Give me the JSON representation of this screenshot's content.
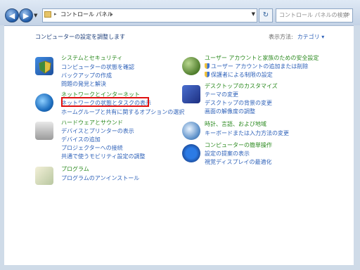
{
  "address": {
    "crumbs": [
      "コントロール パネル"
    ],
    "search_placeholder": "コントロール パネルの検索"
  },
  "heading": "コンピューターの設定を調整します",
  "view": {
    "label": "表示方法:",
    "value": "カテゴリ ▾"
  },
  "left": [
    {
      "title": "システムとセキュリティ",
      "links": [
        "コンピューターの状態を確認",
        "バックアップの作成",
        "問題の発見と解決"
      ]
    },
    {
      "title": "ネットワークとインターネット",
      "links": [
        "ネットワークの状態とタスクの表示",
        "ホームグループと共有に関するオプションの選択"
      ]
    },
    {
      "title": "ハードウェアとサウンド",
      "links": [
        "デバイスとプリンターの表示",
        "デバイスの追加",
        "プロジェクターへの接続",
        "共通で使うモビリティ設定の調整"
      ]
    },
    {
      "title": "プログラム",
      "links": [
        "プログラムのアンインストール"
      ]
    }
  ],
  "right": [
    {
      "title": "ユーザー アカウントと家族のための安全設定",
      "links": [
        "ユーザー アカウントの追加または削除",
        "保護者による制限の設定"
      ]
    },
    {
      "title": "デスクトップのカスタマイズ",
      "links": [
        "テーマの変更",
        "デスクトップの背景の変更",
        "画面の解像度の調整"
      ]
    },
    {
      "title": "時計、言語、および地域",
      "links": [
        "キーボードまたは入力方法の変更"
      ]
    },
    {
      "title": "コンピューターの簡単操作",
      "links": [
        "設定の提案の表示",
        "視覚ディスプレイの最適化"
      ]
    }
  ],
  "icons": {
    "left": [
      "system-security-icon",
      "network-icon",
      "hardware-sound-icon",
      "programs-icon"
    ],
    "right": [
      "user-accounts-icon",
      "desktop-customize-icon",
      "clock-region-icon",
      "ease-of-access-icon"
    ]
  },
  "colors": {
    "category_title": "#2b8a1f",
    "link": "#2f62b9",
    "highlight": "#e01010"
  }
}
